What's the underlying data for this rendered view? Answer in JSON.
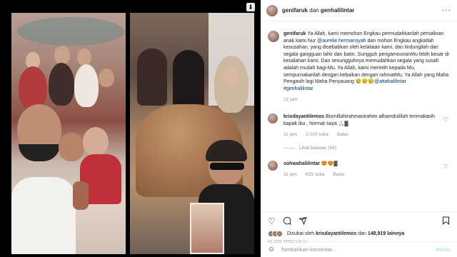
{
  "header": {
    "username": "genifaruk",
    "connector": "dan",
    "collaborator": "genhalilintar",
    "more": "···"
  },
  "caption": {
    "author": "genifaruk",
    "text_1": "Ya Allah, kami memohon Engkau permudahkanlah persalinan anak kami Nur",
    "mention_1": "@aurelie.hermansyah",
    "text_2": "dan mohon Engkau angkatlah kesusahan, yang disebabkan oleh kelalaian kami, dan lindungilah dari segala gangguan lahir dan batin. Sungguh pengamounanMu lebih besar dr kesalahan kami. Dan sesungguhnya memudahkan segala yang susah adalah mudah bagi-Mu. Ya Allah, kami merintih kepada Mu, sempurnakanlah dengan kebaikan dengan rahmatMu, Ya Allah yang Maha Pengasih lagi Maha Penyauang",
    "emoji": "😢😢😢",
    "mention_2": "@attahalilintar",
    "hashtag": "#genhalilintar",
    "time": "12 jam"
  },
  "comments": [
    {
      "username": "krisdayantilemos",
      "text": "Bismillahirahmanirahim alhamdulillah terimakasih bapak ibu , hormat saya 🙏🏻▓",
      "time": "11 jam",
      "likes": "2.010 suka",
      "reply": "Balas",
      "replies": "Lihat balasan (54)"
    },
    {
      "username": "sohwahalilintar",
      "text": "😍😍▓",
      "time": "11 jam",
      "likes": "825 suka",
      "reply": "Balas"
    }
  ],
  "liked_by": {
    "prefix": "Disukai oleh",
    "user": "krisdayantilemos",
    "mid": "dan",
    "count": "148,919 lainnya"
  },
  "posted_ago": "12 JAM YANG LALU",
  "comment_box": {
    "placeholder": "Tambahkan komentar...",
    "post_label": "Kirim"
  },
  "icons": {
    "like": "heart-icon",
    "comment": "comment-icon",
    "share": "paper-plane-icon",
    "save": "bookmark-icon",
    "emoji": "smiley-icon",
    "download": "download-icon"
  },
  "colors": {
    "link": "#00376b",
    "muted": "#8e8e8e",
    "post_button": "#b2dffc"
  }
}
